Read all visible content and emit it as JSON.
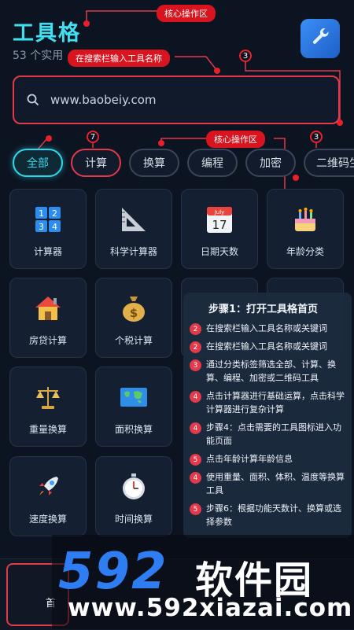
{
  "header": {
    "title": "工具格",
    "subtitle": "53 个实用"
  },
  "annotations": {
    "core_zone_top": "核心操作区",
    "search_hint": "在搜索栏输入工具名称",
    "core_zone_mid": "核心操作区",
    "badge_search": "3",
    "badge_tab_a": "7",
    "badge_tab_b": "3"
  },
  "search": {
    "placeholder": "www.baobeiy.com"
  },
  "tabs": [
    {
      "label": "全部",
      "active": true
    },
    {
      "label": "计算"
    },
    {
      "label": "换算"
    },
    {
      "label": "编程"
    },
    {
      "label": "加密"
    },
    {
      "label": "二维码生"
    }
  ],
  "tools": [
    {
      "label": "计算器",
      "icon": "calculator-icon"
    },
    {
      "label": "科学计算器",
      "icon": "ruler-triangle-icon"
    },
    {
      "label": "日期天数",
      "icon": "calendar-icon",
      "calendar_month": "July",
      "calendar_day": "17"
    },
    {
      "label": "年龄分类",
      "icon": "birthday-cake-icon"
    },
    {
      "label": "房贷计算",
      "icon": "house-icon"
    },
    {
      "label": "个税计算",
      "icon": "money-bag-icon"
    },
    {
      "label": "重量换算",
      "icon": "scales-icon"
    },
    {
      "label": "面积换算",
      "icon": "world-map-icon"
    },
    {
      "label": "速度换算",
      "icon": "rocket-icon"
    },
    {
      "label": "时间换算",
      "icon": "stopwatch-icon"
    }
  ],
  "steps_panel": {
    "title": "步骤1：打开工具格首页",
    "steps": [
      {
        "num": "2",
        "text": "在搜索栏输入工具名称或关键词"
      },
      {
        "num": "2",
        "text": "在搜索栏输入工具名称或关键词"
      },
      {
        "num": "3",
        "text": "通过分类标签筛选全部、计算、换算、编程、加密或二维码工具"
      },
      {
        "num": "4",
        "text": "点击计算器进行基础运算，点击科学计算器进行复杂计算"
      },
      {
        "num": "4",
        "text": "步骤4：点击需要的工具图标进入功能页面"
      },
      {
        "num": "5",
        "text": "点击年龄计算年龄信息"
      },
      {
        "num": "4",
        "text": "使用重量、面积、体积、温度等换算工具"
      },
      {
        "num": "5",
        "text": "步骤6：根据功能天数计、换算或选择参数"
      }
    ]
  },
  "bottom_nav": {
    "home_label": "首"
  },
  "watermark": {
    "logo": "592",
    "brand_cn": "软件园",
    "url": "www.592xiazai.com"
  },
  "colors": {
    "accent": "#30d9ea",
    "annotation_red": "#e23a4a",
    "background": "#0c1422",
    "watermark_blue": "#2f7df2"
  }
}
